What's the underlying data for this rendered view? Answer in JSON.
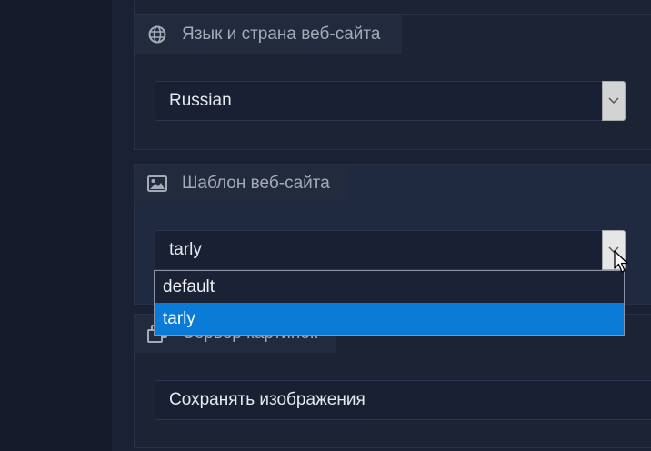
{
  "sections": {
    "language": {
      "title": "Язык и страна веб-сайта",
      "icon": "globe-icon",
      "selected_value": "Russian"
    },
    "template": {
      "title": "Шаблон веб-сайта",
      "icon": "image-icon",
      "selected_value": "tarly",
      "options": [
        "default",
        "tarly"
      ],
      "highlighted_option": "tarly"
    },
    "image_server": {
      "title": "Сервер картинок",
      "icon": "images-icon",
      "selected_value": "Сохранять изображения"
    }
  },
  "colors": {
    "accent_highlight": "#0a7bd6",
    "background": "#1a2134",
    "card_header": "#222a3d"
  }
}
